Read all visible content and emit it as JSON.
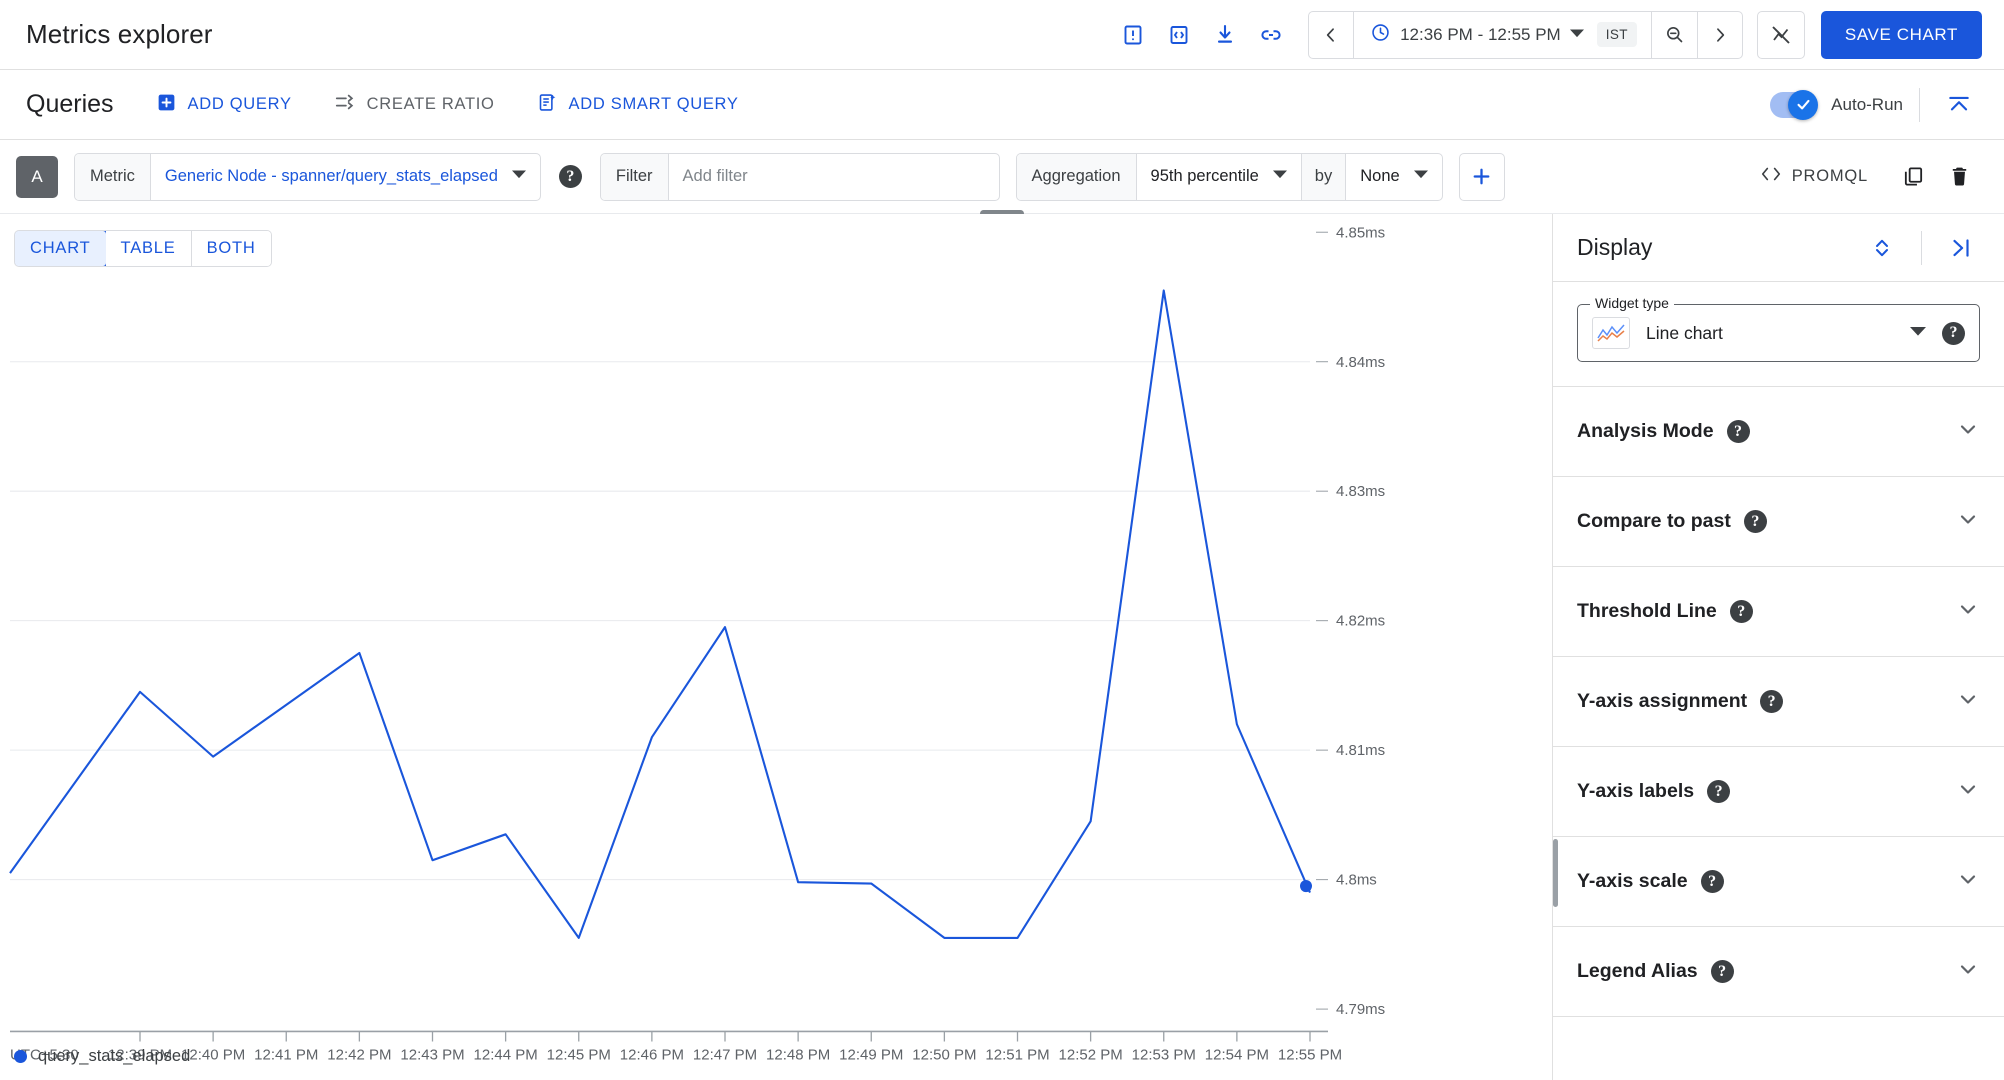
{
  "header": {
    "title": "Metrics explorer",
    "icons": [
      {
        "name": "annotation-icon",
        "title": "Annotations"
      },
      {
        "name": "code-icon",
        "title": "View code"
      },
      {
        "name": "download-icon",
        "title": "Download"
      },
      {
        "name": "link-icon",
        "title": "Share link"
      }
    ],
    "time": {
      "prev_label": "Previous time period",
      "clock_icon": "clock-icon",
      "range": "12:36 PM - 12:55 PM",
      "timezone": "IST",
      "zoom_out_icon": "zoom-out-icon",
      "next_label": "Next time period"
    },
    "reset_zoom_label": "Reset zoom",
    "save_chart_label": "SAVE CHART"
  },
  "queries": {
    "title": "Queries",
    "add_query_label": "ADD QUERY",
    "create_ratio_label": "CREATE RATIO",
    "add_smart_query_label": "ADD SMART QUERY",
    "auto_run_label": "Auto-Run",
    "auto_run_on": true,
    "collapse_label": "Collapse all"
  },
  "query_row": {
    "badge": "A",
    "metric_label": "Metric",
    "metric_value": "Generic Node - spanner/query_stats_elapsed",
    "filter_label": "Filter",
    "filter_placeholder": "Add filter",
    "filter_value": "",
    "aggregation_label": "Aggregation",
    "aggregation_value": "95th percentile",
    "by_label": "by",
    "by_value": "None",
    "add_label": "Add aggregation",
    "promql_label": "PROMQL",
    "duplicate_label": "Duplicate query",
    "delete_label": "Delete query"
  },
  "view_tabs": [
    {
      "label": "CHART",
      "active": true
    },
    {
      "label": "TABLE",
      "active": false
    },
    {
      "label": "BOTH",
      "active": false
    }
  ],
  "display": {
    "title": "Display",
    "expand_icon": "unfold-more-icon",
    "collapse_panel_icon": "panel-collapse-icon",
    "widget_type_legend": "Widget type",
    "widget_type_value": "Line chart",
    "sections": [
      {
        "label": "Analysis Mode"
      },
      {
        "label": "Compare to past"
      },
      {
        "label": "Threshold Line"
      },
      {
        "label": "Y-axis assignment"
      },
      {
        "label": "Y-axis labels"
      },
      {
        "label": "Y-axis scale"
      },
      {
        "label": "Legend Alias"
      }
    ]
  },
  "chart_data": {
    "type": "line",
    "title": "",
    "xlabel": "",
    "ylabel": "",
    "timezone_label": "UTC+5:30",
    "unit": "ms",
    "line_color": "#1a56db",
    "grid": true,
    "legend_position": "bottom-left",
    "ylim": [
      4.79,
      4.85
    ],
    "ytick_labels": [
      "4.85ms",
      "4.84ms",
      "4.83ms",
      "4.82ms",
      "4.81ms",
      "4.8ms",
      "4.79ms"
    ],
    "ytick_values": [
      4.85,
      4.84,
      4.83,
      4.82,
      4.81,
      4.8,
      4.79
    ],
    "xtick_labels": [
      "12:39 PM",
      "12:40 PM",
      "12:41 PM",
      "12:42 PM",
      "12:43 PM",
      "12:44 PM",
      "12:45 PM",
      "12:46 PM",
      "12:47 PM",
      "12:48 PM",
      "12:49 PM",
      "12:50 PM",
      "12:51 PM",
      "12:52 PM",
      "12:53 PM",
      "12:54 PM",
      "12:55 PM"
    ],
    "series": [
      {
        "name": "query_stats_elapsed",
        "color": "#1a56db",
        "x": [
          "12:38 PM",
          "12:39 PM",
          "12:40 PM",
          "12:41 PM",
          "12:42 PM",
          "12:43 PM",
          "12:44 PM",
          "12:45 PM",
          "12:46 PM",
          "12:47 PM",
          "12:48 PM",
          "12:49 PM",
          "12:50 PM",
          "12:51 PM",
          "12:52 PM",
          "12:53 PM",
          "12:54 PM",
          "12:55 PM"
        ],
        "values": [
          4.8005,
          4.8145,
          4.8095,
          4.8135,
          4.8175,
          4.8015,
          4.8035,
          4.7955,
          4.811,
          4.8195,
          4.7998,
          4.7997,
          4.7955,
          4.7955,
          4.8045,
          4.8455,
          4.812,
          4.799
        ],
        "end_marker": {
          "x": "12:55 PM",
          "value": 4.7995
        }
      }
    ]
  },
  "legend": {
    "items": [
      {
        "label": "query_stats_elapsed",
        "color": "#1a56db"
      }
    ]
  }
}
